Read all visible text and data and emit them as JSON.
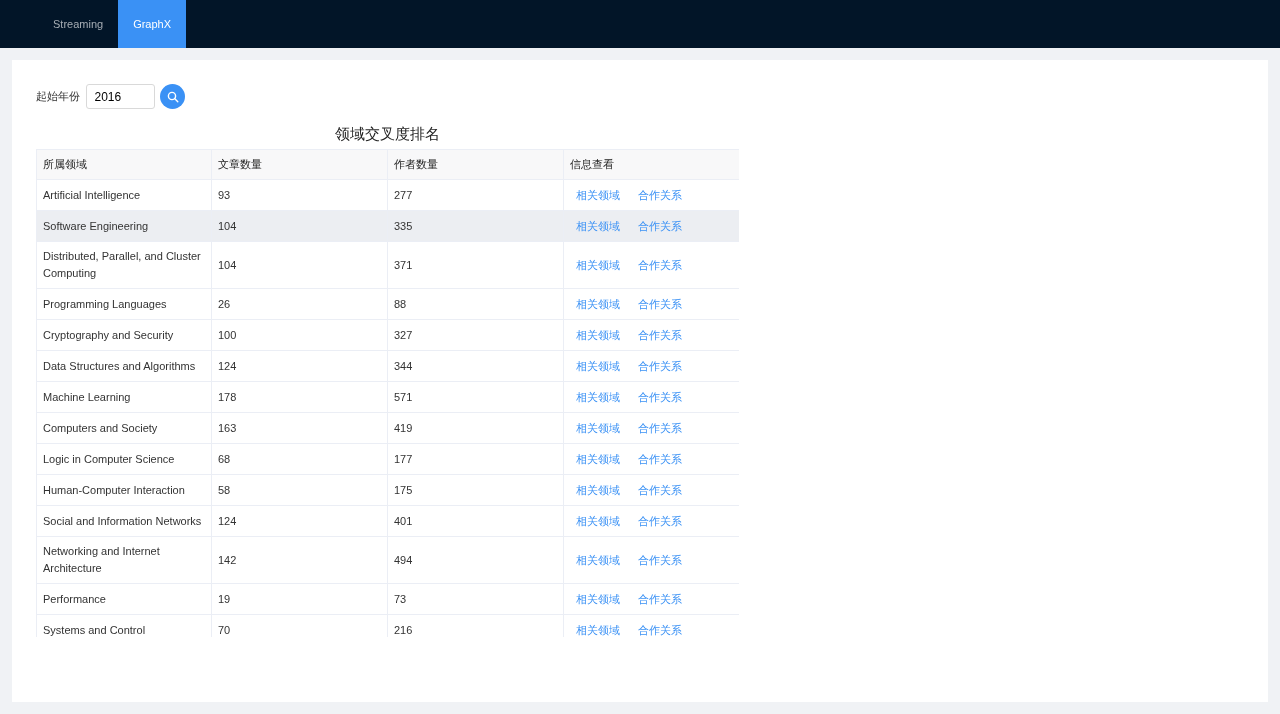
{
  "nav": {
    "tabs": [
      {
        "label": "Streaming",
        "selected": false
      },
      {
        "label": "GraphX",
        "selected": true
      }
    ]
  },
  "search": {
    "label": "起始年份",
    "value": "2016"
  },
  "table": {
    "title": "领域交叉度排名",
    "columns": [
      "所属领域",
      "文章数量",
      "作者数量",
      "信息查看"
    ],
    "rows": [
      {
        "field": "Artificial Intelligence",
        "articles": "93",
        "authors": "277",
        "links": [
          "相关领域",
          "合作关系"
        ],
        "hovered": false
      },
      {
        "field": "Software Engineering",
        "articles": "104",
        "authors": "335",
        "links": [
          "相关领域",
          "合作关系"
        ],
        "hovered": true
      },
      {
        "field": "Distributed, Parallel, and Cluster Computing",
        "articles": "104",
        "authors": "371",
        "links": [
          "相关领域",
          "合作关系"
        ],
        "hovered": false
      },
      {
        "field": "Programming Languages",
        "articles": "26",
        "authors": "88",
        "links": [
          "相关领域",
          "合作关系"
        ],
        "hovered": false
      },
      {
        "field": "Cryptography and Security",
        "articles": "100",
        "authors": "327",
        "links": [
          "相关领域",
          "合作关系"
        ],
        "hovered": false
      },
      {
        "field": "Data Structures and Algorithms",
        "articles": "124",
        "authors": "344",
        "links": [
          "相关领域",
          "合作关系"
        ],
        "hovered": false
      },
      {
        "field": "Machine Learning",
        "articles": "178",
        "authors": "571",
        "links": [
          "相关领域",
          "合作关系"
        ],
        "hovered": false
      },
      {
        "field": "Computers and Society",
        "articles": "163",
        "authors": "419",
        "links": [
          "相关领域",
          "合作关系"
        ],
        "hovered": false
      },
      {
        "field": "Logic in Computer Science",
        "articles": "68",
        "authors": "177",
        "links": [
          "相关领域",
          "合作关系"
        ],
        "hovered": false
      },
      {
        "field": "Human-Computer Interaction",
        "articles": "58",
        "authors": "175",
        "links": [
          "相关领域",
          "合作关系"
        ],
        "hovered": false
      },
      {
        "field": "Social and Information Networks",
        "articles": "124",
        "authors": "401",
        "links": [
          "相关领域",
          "合作关系"
        ],
        "hovered": false
      },
      {
        "field": "Networking and Internet Architecture",
        "articles": "142",
        "authors": "494",
        "links": [
          "相关领域",
          "合作关系"
        ],
        "hovered": false
      },
      {
        "field": "Performance",
        "articles": "19",
        "authors": "73",
        "links": [
          "相关领域",
          "合作关系"
        ],
        "hovered": false
      },
      {
        "field": "Systems and Control",
        "articles": "70",
        "authors": "216",
        "links": [
          "相关领域",
          "合作关系"
        ],
        "hovered": false
      }
    ]
  }
}
